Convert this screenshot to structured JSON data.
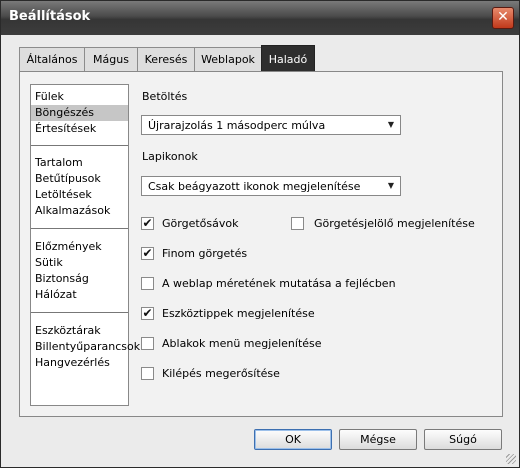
{
  "window": {
    "title": "Beállítások",
    "close_glyph": "✕"
  },
  "tabs": [
    {
      "label": "Általános"
    },
    {
      "label": "Mágus"
    },
    {
      "label": "Keresés"
    },
    {
      "label": "Weblapok"
    },
    {
      "label": "Haladó",
      "active": true
    }
  ],
  "categories": {
    "group1": [
      "Fülek",
      "Böngészés",
      "Értesítések"
    ],
    "group2": [
      "Tartalom",
      "Betűtípusok",
      "Letöltések",
      "Alkalmazások"
    ],
    "group3": [
      "Előzmények",
      "Sütik",
      "Biztonság",
      "Hálózat"
    ],
    "group4": [
      "Eszköztárak",
      "Billentyűparancsok",
      "Hangvezérlés"
    ],
    "selected": "Böngészés"
  },
  "loading": {
    "heading": "Betöltés",
    "value": "Újrarajzolás 1 másodperc múlva"
  },
  "icons_section": {
    "heading": "Lapikonok",
    "value": "Csak beágyazott ikonok megjelenítése"
  },
  "options": {
    "scrollbars": {
      "label": "Görgetősávok",
      "checked": true
    },
    "scroll_marker": {
      "label": "Görgetésjelölő megjelenítése",
      "checked": false
    },
    "smooth_scroll": {
      "label": "Finom görgetés",
      "checked": true
    },
    "page_size_title": {
      "label": "A weblap méretének mutatása a fejlécben",
      "checked": false
    },
    "tooltips": {
      "label": "Eszköztippek megjelenítése",
      "checked": true
    },
    "window_menu": {
      "label": "Ablakok menü megjelenítése",
      "checked": false
    },
    "exit_confirm": {
      "label": "Kilépés megerősítése",
      "checked": false
    }
  },
  "buttons": {
    "ok": "OK",
    "cancel": "Mégse",
    "help": "Súgó"
  },
  "icons": {
    "check": "✔",
    "dropdown_arrow": "▼"
  }
}
